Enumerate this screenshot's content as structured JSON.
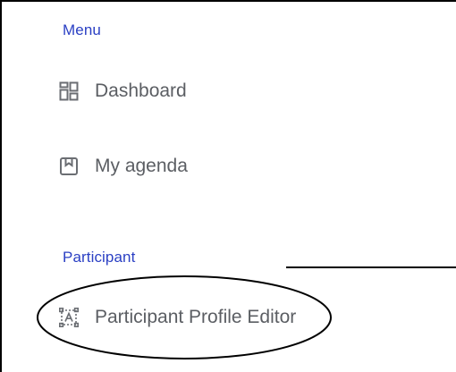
{
  "sidebar": {
    "sections": [
      {
        "header": "Menu",
        "items": [
          {
            "label": "Dashboard",
            "icon": "dashboard-grid-icon"
          },
          {
            "label": "My agenda",
            "icon": "agenda-bookmark-icon"
          }
        ]
      },
      {
        "header": "Participant",
        "items": [
          {
            "label": "Participant Profile Editor",
            "icon": "profile-editor-icon"
          }
        ]
      }
    ]
  },
  "colors": {
    "section_header": "#2b40c4",
    "item_text": "#5b5e63",
    "icon": "#6b6e73",
    "annotation": "#000000"
  }
}
